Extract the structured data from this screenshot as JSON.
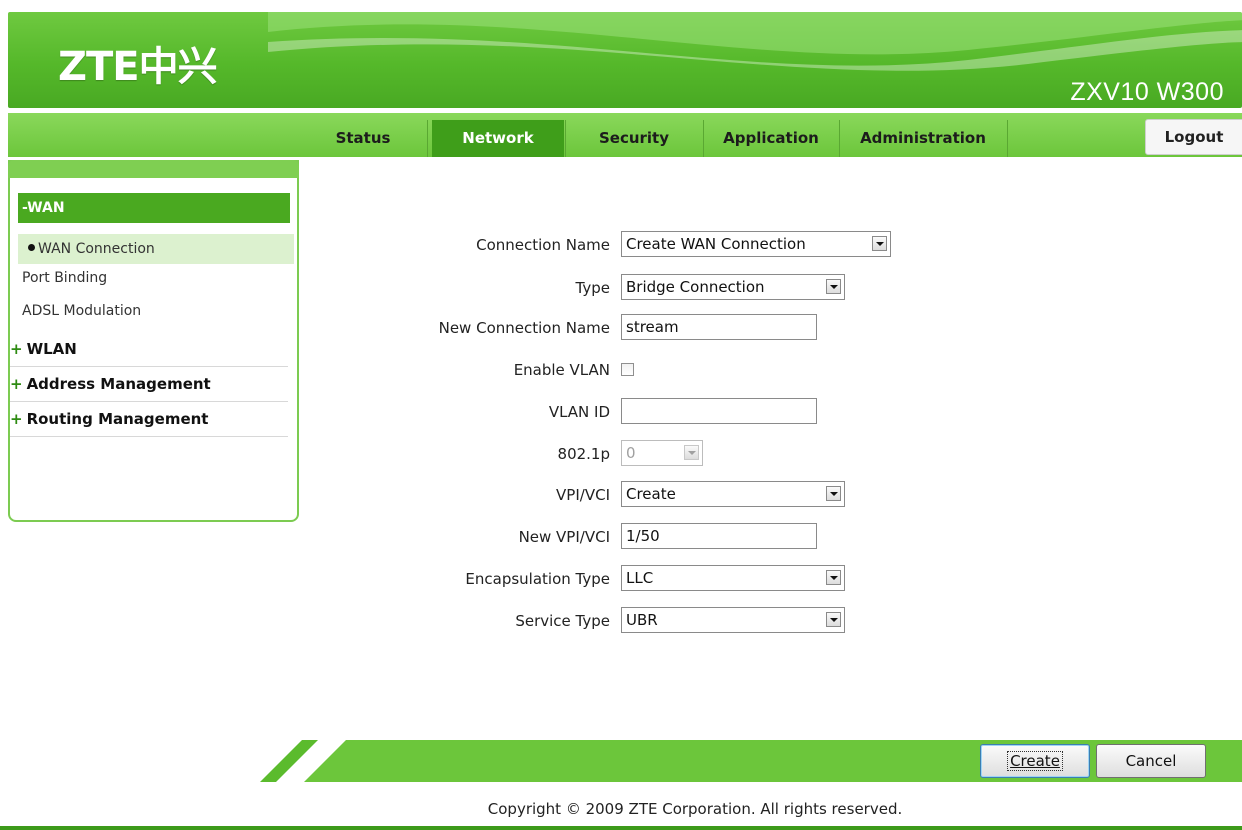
{
  "header": {
    "logo": "ZTE中兴",
    "model": "ZXV10 W300"
  },
  "nav": {
    "tabs": [
      {
        "label": "Status",
        "active": false
      },
      {
        "label": "Network",
        "active": true
      },
      {
        "label": "Security",
        "active": false
      },
      {
        "label": "Application",
        "active": false
      },
      {
        "label": "Administration",
        "active": false
      }
    ],
    "logout": "Logout"
  },
  "sidebar": {
    "section": "-WAN",
    "items": [
      {
        "label": "WAN Connection",
        "selected": true
      },
      {
        "label": "Port Binding",
        "selected": false
      },
      {
        "label": "ADSL Modulation",
        "selected": false
      }
    ],
    "groups": [
      {
        "label": "WLAN"
      },
      {
        "label": "Address Management"
      },
      {
        "label": "Routing Management"
      }
    ]
  },
  "form": {
    "connection_name": {
      "label": "Connection Name",
      "value": "Create WAN Connection"
    },
    "type": {
      "label": "Type",
      "value": "Bridge Connection"
    },
    "new_connection_name": {
      "label": "New Connection Name",
      "value": "stream"
    },
    "enable_vlan": {
      "label": "Enable VLAN",
      "checked": false
    },
    "vlan_id": {
      "label": "VLAN ID",
      "value": ""
    },
    "priority": {
      "label": "802.1p",
      "value": "0",
      "disabled": true
    },
    "vpi_vci": {
      "label": "VPI/VCI",
      "value": "Create"
    },
    "new_vpi_vci": {
      "label": "New VPI/VCI",
      "value": "1/50"
    },
    "encapsulation": {
      "label": "Encapsulation Type",
      "value": "LLC"
    },
    "service_type": {
      "label": "Service Type",
      "value": "UBR"
    }
  },
  "actions": {
    "create": "Create",
    "cancel": "Cancel"
  },
  "footer": {
    "copyright": "Copyright © 2009 ZTE Corporation. All rights reserved."
  },
  "colors": {
    "brand_green": "#55b82a",
    "active_tab": "#3f9e1a",
    "nav_green": "#6cc63b",
    "selected_item_bg": "#dcf1cf"
  }
}
